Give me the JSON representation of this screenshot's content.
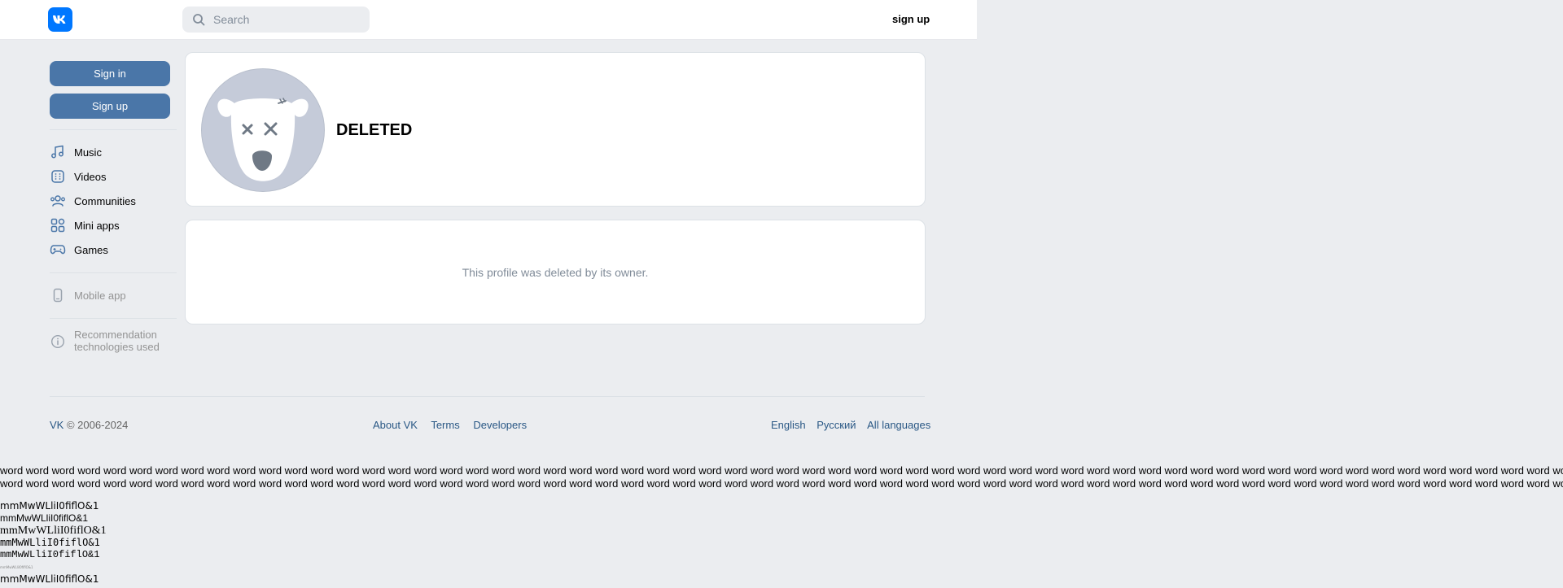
{
  "header": {
    "logo_icon": "vk-logo-icon",
    "search_placeholder": "Search",
    "signup_label": "sign up"
  },
  "sidebar": {
    "sign_in_label": "Sign in",
    "sign_up_label": "Sign up",
    "items": [
      {
        "label": "Music",
        "icon": "music-note-icon"
      },
      {
        "label": "Videos",
        "icon": "video-film-icon"
      },
      {
        "label": "Communities",
        "icon": "users-icon"
      },
      {
        "label": "Mini apps",
        "icon": "grid-apps-icon"
      },
      {
        "label": "Games",
        "icon": "gamepad-icon"
      }
    ],
    "mobile_app_label": "Mobile app",
    "recommendation_line1": "Recommendation",
    "recommendation_line2": "technologies used"
  },
  "profile": {
    "name": "DELETED",
    "deleted_message": "This profile was deleted by its owner."
  },
  "footer": {
    "brand": "VK",
    "copyright": "© 2006-2024",
    "links": [
      "About VK",
      "Terms",
      "Developers"
    ],
    "languages": [
      "English",
      "Русский",
      "All languages"
    ]
  },
  "test_text": {
    "words_line": "word word word word word word word word word word word word word word word word word word word word word word word word word word word word word word word word word word word word word word word word word word word word word word word word word word word word word word word word word word word word word word",
    "glyphs": "mmMwWLliI0fiflO&1"
  },
  "colors": {
    "accent_blue": "#4a76a8",
    "vk_blue": "#0077ff",
    "background": "#ebedf0",
    "link": "#2a5885"
  }
}
